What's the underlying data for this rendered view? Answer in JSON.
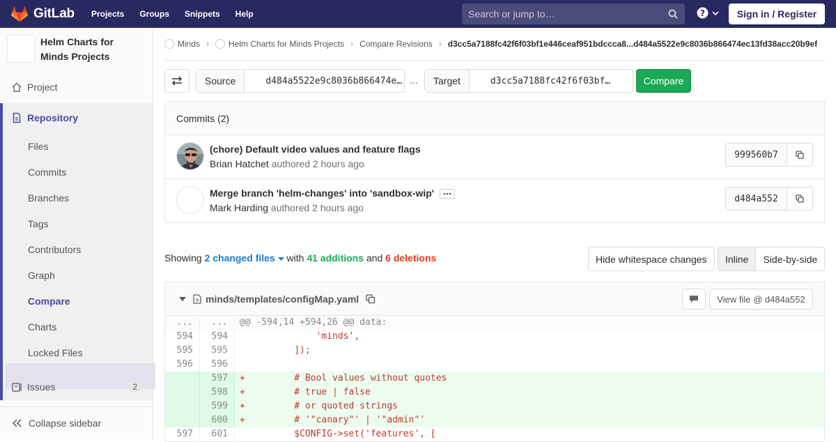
{
  "topbar": {
    "brand": "GitLab",
    "nav": [
      "Projects",
      "Groups",
      "Snippets",
      "Help"
    ],
    "search_placeholder": "Search or jump to…",
    "signin": "Sign in / Register"
  },
  "sidebar": {
    "project_name": "Helm Charts for Minds Projects",
    "project": "Project",
    "repository": "Repository",
    "sub_items": [
      "Files",
      "Commits",
      "Branches",
      "Tags",
      "Contributors",
      "Graph",
      "Compare",
      "Charts",
      "Locked Files"
    ],
    "issues": "Issues",
    "issues_count": "2",
    "collapse": "Collapse sidebar"
  },
  "breadcrumb": {
    "items": [
      "Minds",
      "Helm Charts for Minds Projects",
      "Compare Revisions"
    ],
    "current": "d3cc5a7188fc42f6f03bf1e446ceaf951bdccca8...d484a5522e9c8036b866474ec13fd38acc20b9ef"
  },
  "compare": {
    "source_label": "Source",
    "source_value": "d484a5522e9c8036b866474ec13fd38acc20b9ef",
    "dots": "...",
    "target_label": "Target",
    "target_value": "d3cc5a7188fc42f6f03bf1e446ceaf951bdccca8",
    "button": "Compare"
  },
  "commits": {
    "header": "Commits (2)",
    "items": [
      {
        "title": "(chore) Default video values and feature flags",
        "author": "Brian Hatchet",
        "meta": "authored 2 hours ago",
        "sha": "999560b7"
      },
      {
        "title": "Merge branch 'helm-changes' into 'sandbox-wip'",
        "author": "Mark Harding",
        "meta": "authored 2 hours ago",
        "sha": "d484a552"
      }
    ]
  },
  "stats": {
    "showing": "Showing",
    "changed": "2 changed files",
    "with": "with",
    "additions": "41 additions",
    "and": "and",
    "deletions": "6 deletions"
  },
  "view": {
    "hide_ws": "Hide whitespace changes",
    "inline": "Inline",
    "side_by_side": "Side-by-side"
  },
  "file": {
    "path": "minds/templates/configMap.yaml",
    "view_file": "View file @ d484a552",
    "lines": [
      {
        "old": "...",
        "new": "...",
        "type": "hunk",
        "code": "@@ -594,14 +594,26 @@ data:"
      },
      {
        "old": "594",
        "new": "594",
        "type": "ctx",
        "code": "              'minds',"
      },
      {
        "old": "595",
        "new": "595",
        "type": "ctx",
        "code": "          ]);"
      },
      {
        "old": "596",
        "new": "596",
        "type": "ctx",
        "code": ""
      },
      {
        "old": "",
        "new": "597",
        "type": "add",
        "code": "+         # Bool values without quotes"
      },
      {
        "old": "",
        "new": "598",
        "type": "add",
        "code": "+         # true | false"
      },
      {
        "old": "",
        "new": "599",
        "type": "add",
        "code": "+         # or quoted strings"
      },
      {
        "old": "",
        "new": "600",
        "type": "add",
        "code": "+         # '\"canary\"' | '\"admin\"'"
      },
      {
        "old": "597",
        "new": "601",
        "type": "ctx",
        "code": "          $CONFIG->set('features', ["
      }
    ]
  }
}
